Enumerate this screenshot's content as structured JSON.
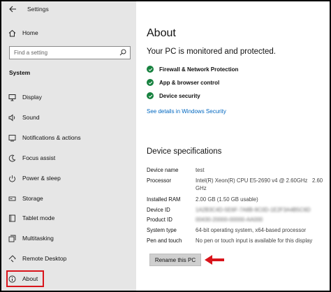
{
  "window": {
    "title": "Settings"
  },
  "sidebar": {
    "home_label": "Home",
    "search_placeholder": "Find a setting",
    "section_label": "System",
    "items": [
      {
        "label": "Display",
        "icon": "display-icon"
      },
      {
        "label": "Sound",
        "icon": "sound-icon"
      },
      {
        "label": "Notifications & actions",
        "icon": "notifications-icon"
      },
      {
        "label": "Focus assist",
        "icon": "focus-assist-icon"
      },
      {
        "label": "Power & sleep",
        "icon": "power-icon"
      },
      {
        "label": "Storage",
        "icon": "storage-icon"
      },
      {
        "label": "Tablet mode",
        "icon": "tablet-mode-icon"
      },
      {
        "label": "Multitasking",
        "icon": "multitasking-icon"
      },
      {
        "label": "Remote Desktop",
        "icon": "remote-desktop-icon"
      },
      {
        "label": "About",
        "icon": "info-icon",
        "selected": true
      }
    ]
  },
  "main": {
    "title": "About",
    "protection": {
      "heading": "Your PC is monitored and protected.",
      "items": [
        "Firewall & Network Protection",
        "App & browser control",
        "Device security"
      ],
      "link": "See details in Windows Security"
    },
    "specs": {
      "heading": "Device specifications",
      "rows": [
        {
          "key": "Device name",
          "value": "test"
        },
        {
          "key": "Processor",
          "value": "Intel(R) Xeon(R) CPU E5-2690 v4 @ 2.60GHz   2.60 GHz"
        },
        {
          "key": "Installed RAM",
          "value": "2.00 GB (1.50 GB usable)"
        },
        {
          "key": "Device ID",
          "value": "1A2B3C4D-5E6F-7A8B-9C0D-1E2F3A4B5C6D",
          "obscured": true
        },
        {
          "key": "Product ID",
          "value": "00430-20000-00000-AA000",
          "obscured": true
        },
        {
          "key": "System type",
          "value": "64-bit operating system, x64-based processor"
        },
        {
          "key": "Pen and touch",
          "value": "No pen or touch input is available for this display"
        }
      ]
    },
    "rename_button": "Rename this PC"
  },
  "colors": {
    "sidebar_bg": "#e6e6e6",
    "check_green": "#16813e",
    "link_blue": "#0067c0",
    "highlight_red": "#d9141b"
  }
}
